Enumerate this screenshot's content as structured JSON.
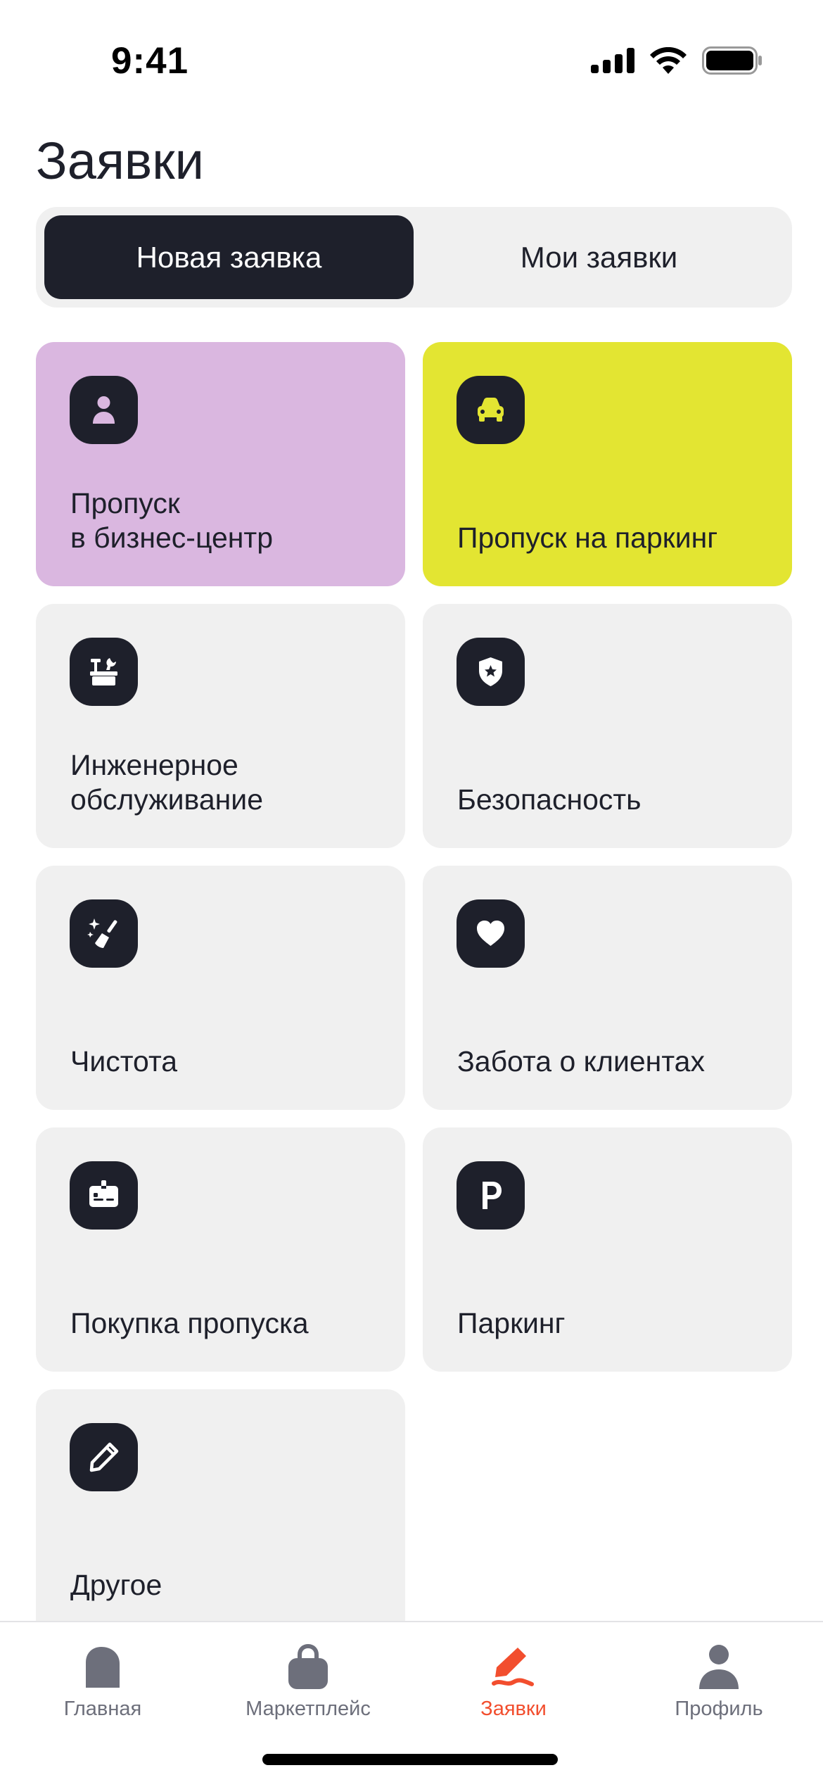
{
  "status_bar": {
    "time": "9:41"
  },
  "page": {
    "title": "Заявки"
  },
  "segmented": {
    "tabs": [
      {
        "label": "Новая заявка",
        "selected": true
      },
      {
        "label": "Мои заявки",
        "selected": false
      }
    ]
  },
  "categories": [
    {
      "label": "Пропуск\nв бизнес-центр",
      "icon": "person-icon",
      "background": "#dab7e0",
      "icon_color": "#dab7e0"
    },
    {
      "label": "Пропуск на паркинг",
      "icon": "car-icon",
      "background": "#e3e532",
      "icon_color": "#e3e532"
    },
    {
      "label": "Инженерное\nобслуживание",
      "icon": "toolbox-icon",
      "background": "#f0f0f0"
    },
    {
      "label": "Безопасность",
      "icon": "shield-star-icon",
      "background": "#f0f0f0"
    },
    {
      "label": "Чистота",
      "icon": "broom-sparkle-icon",
      "background": "#f0f0f0"
    },
    {
      "label": "Забота о клиентах",
      "icon": "heart-icon",
      "background": "#f0f0f0"
    },
    {
      "label": "Покупка пропуска",
      "icon": "badge-card-icon",
      "background": "#f0f0f0"
    },
    {
      "label": "Паркинг",
      "icon": "parking-p-icon",
      "background": "#f0f0f0"
    },
    {
      "label": "Другое",
      "icon": "pencil-icon",
      "background": "#f0f0f0"
    }
  ],
  "tab_bar": {
    "items": [
      {
        "label": "Главная",
        "icon": "home-arch-icon",
        "active": false
      },
      {
        "label": "Маркетплейс",
        "icon": "shopping-bag-icon",
        "active": false
      },
      {
        "label": "Заявки",
        "icon": "pen-request-icon",
        "active": true
      },
      {
        "label": "Профиль",
        "icon": "profile-person-icon",
        "active": false
      }
    ]
  },
  "colors": {
    "dark": "#1e202b",
    "accent": "#f24e2e",
    "inactive_tab": "#6d6f7b",
    "card_gray": "#f0f0f0"
  }
}
